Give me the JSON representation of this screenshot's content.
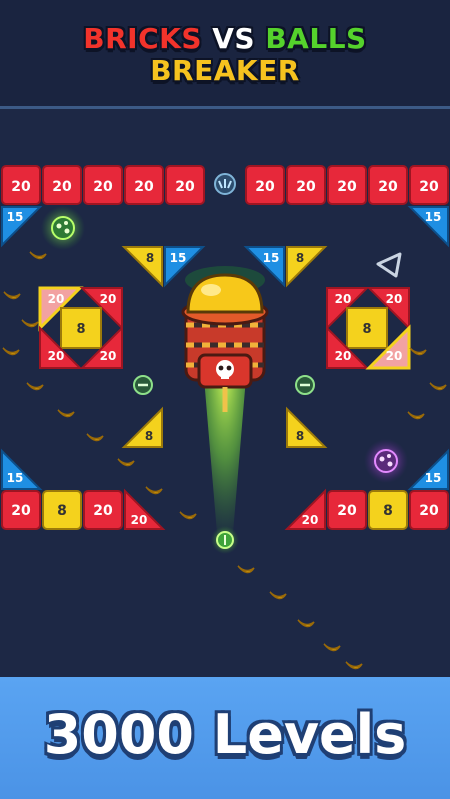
{
  "header": {
    "title_line1": [
      "BRICKS",
      "VS",
      "BALLS"
    ],
    "title_line2": "BREAKER"
  },
  "colors": {
    "brick_red": "#e7283a",
    "brick_yellow": "#f4d21d",
    "brick_blue": "#1f8fe3",
    "brick_pink": "#f2a2a2",
    "background": "#1d2845",
    "footer_blue": "#5aa4f2"
  },
  "bricks": {
    "top_row_left": [
      "20",
      "20",
      "20",
      "20",
      "20"
    ],
    "top_row_right": [
      "20",
      "20",
      "20",
      "20",
      "20"
    ],
    "corner_left": "15",
    "corner_right": "15",
    "mid_left_tri": [
      "8",
      "15"
    ],
    "mid_right_tri": [
      "15",
      "8"
    ],
    "left_cluster": {
      "center": "8",
      "corners": [
        "20",
        "20",
        "20",
        "20"
      ]
    },
    "right_cluster": {
      "center": "8",
      "corners": [
        "20",
        "20",
        "20",
        "20"
      ]
    },
    "side_tri_left": "8",
    "side_tri_right": "8",
    "low_corner_left": "15",
    "low_corner_right": "15",
    "bottom_row_left": [
      "20",
      "8",
      "20",
      "20"
    ],
    "bottom_row_right": [
      "20",
      "20",
      "8",
      "20"
    ]
  },
  "icons": [
    "cannon-icon",
    "skull-icon",
    "triangle-pointer-icon",
    "green-ball-icon",
    "purple-ball-icon",
    "banana-icon",
    "split-powerup-icon",
    "minus-powerup-icon"
  ],
  "footer": {
    "caption": "3000 Levels"
  }
}
